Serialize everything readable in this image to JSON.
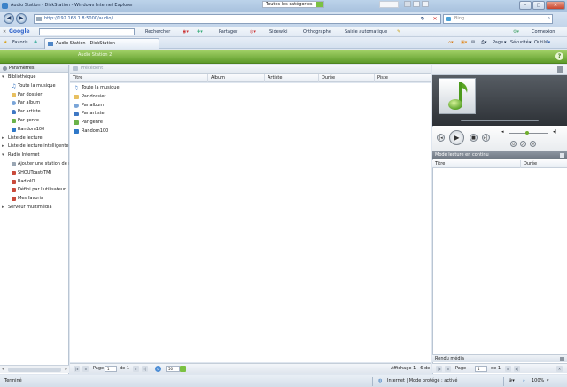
{
  "window": {
    "title": "Audio Station - DiskStation - Windows Internet Explorer"
  },
  "address": {
    "url": "http://192.168.1.8:5000/audio/",
    "search_placeholder": "Bing"
  },
  "google_toolbar": {
    "logo": "Google",
    "search_label": "Rechercher",
    "share_label": "Partager",
    "sidewiki_label": "Sidewiki",
    "spell_label": "Orthographe",
    "autofill_label": "Saisie automatique",
    "signin_label": "Connexion"
  },
  "favorites_bar": {
    "favorites_label": "Favoris",
    "tab_title": "Audio Station - DiskStation",
    "page_label": "Page",
    "safety_label": "Sécurité",
    "tools_label": "Outils"
  },
  "app": {
    "title": "Audio Station 2",
    "accent": "#6fae2c",
    "help_icon": "?"
  },
  "left_panel": {
    "settings_label": "Paramètres",
    "tree": [
      {
        "label": "Bibliothèque",
        "level": 0,
        "arrow": "▾",
        "icon": ""
      },
      {
        "label": "Toute la musique",
        "level": 1,
        "arrow": "",
        "icon": "note-icon"
      },
      {
        "label": "Par dossier",
        "level": 1,
        "arrow": "",
        "icon": "folder-icon"
      },
      {
        "label": "Par album",
        "level": 1,
        "arrow": "",
        "icon": "disc-icon"
      },
      {
        "label": "Par artiste",
        "level": 1,
        "arrow": "",
        "icon": "person-icon"
      },
      {
        "label": "Par genre",
        "level": 1,
        "arrow": "",
        "icon": "genre-icon"
      },
      {
        "label": "Random100",
        "level": 1,
        "arrow": "",
        "icon": "random-icon"
      },
      {
        "label": "Liste de lecture",
        "level": 0,
        "arrow": "▸",
        "icon": ""
      },
      {
        "label": "Liste de lecture intelligente",
        "level": 0,
        "arrow": "▸",
        "icon": ""
      },
      {
        "label": "Radio Internet",
        "level": 0,
        "arrow": "▾",
        "icon": ""
      },
      {
        "label": "Ajouter une station de rad",
        "level": 1,
        "arrow": "",
        "icon": "add-radio-icon"
      },
      {
        "label": "SHOUTcast(TM)",
        "level": 1,
        "arrow": "",
        "icon": "radio-icon"
      },
      {
        "label": "RadioIO",
        "level": 1,
        "arrow": "",
        "icon": "radio-icon"
      },
      {
        "label": "Défini par l'utilisateur",
        "level": 1,
        "arrow": "",
        "icon": "radio-icon"
      },
      {
        "label": "Mes favoris",
        "level": 1,
        "arrow": "",
        "icon": "radio-icon"
      },
      {
        "label": "Serveur multimédia",
        "level": 0,
        "arrow": "▸",
        "icon": ""
      }
    ]
  },
  "main": {
    "back_label": "Précédent",
    "category_select": "Toutes les catégories",
    "columns": [
      "Titre",
      "Album",
      "Artiste",
      "Durée",
      "Piste"
    ],
    "rows": [
      {
        "label": "Toute la musique",
        "icon": "note-icon"
      },
      {
        "label": "Par dossier",
        "icon": "folder-icon"
      },
      {
        "label": "Par album",
        "icon": "disc-icon"
      },
      {
        "label": "Par artiste",
        "icon": "person-icon"
      },
      {
        "label": "Par genre",
        "icon": "genre-icon"
      },
      {
        "label": "Random100",
        "icon": "random-icon"
      }
    ],
    "pager": {
      "page_label": "Page",
      "page_value": "1",
      "of_label": "de 1",
      "page_size": "50",
      "display_text": "Affichage 1 - 6 de 6"
    }
  },
  "player": {
    "mode_title": "Mode lecture en continu",
    "queue_columns": [
      "Titre",
      "Durée"
    ],
    "renderer_title": "Rendu média",
    "pager": {
      "page_label": "Page",
      "page_value": "1",
      "of_label": "de 1"
    }
  },
  "statusbar": {
    "left_text": "Terminé",
    "zone_text": "Internet | Mode protégé : activé",
    "zoom": "100%"
  }
}
